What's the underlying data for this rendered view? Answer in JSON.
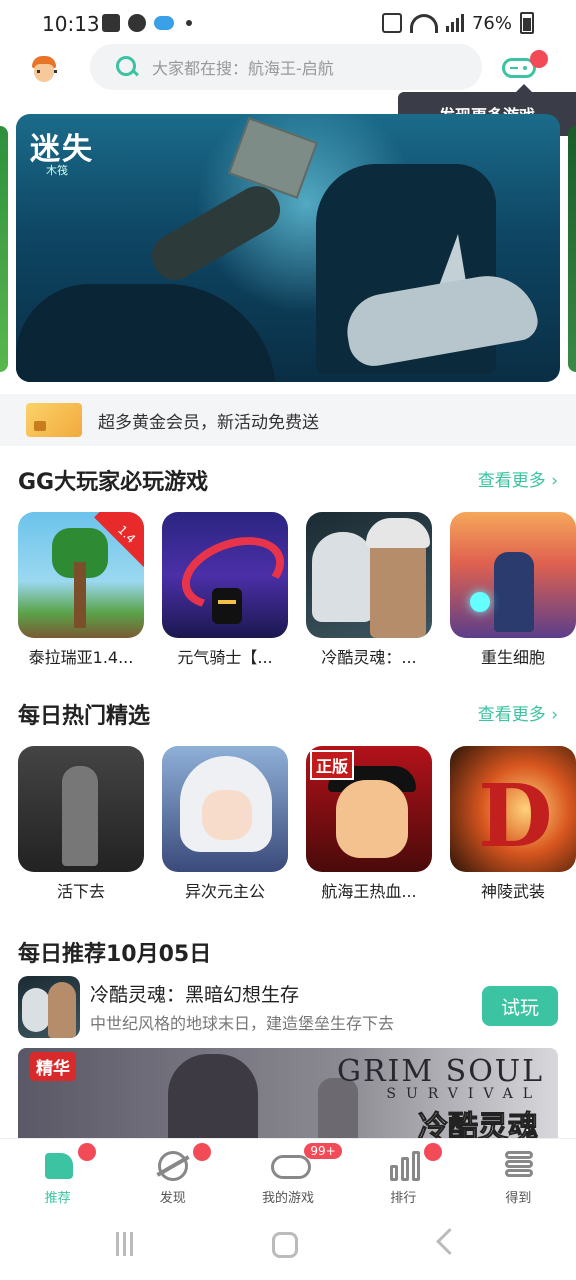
{
  "status_bar": {
    "time": "10:13",
    "battery": "76%"
  },
  "header": {
    "search_placeholder": "大家都在搜：航海王-启航",
    "tooltip": "发现更多游戏"
  },
  "banner": {
    "logo": "迷失",
    "logo_sub": "木筏"
  },
  "promo": {
    "text": "超多黄金会员，新活动免费送"
  },
  "section1": {
    "title": "GG大玩家必玩游戏",
    "more": "查看更多",
    "games": [
      {
        "name": "泰拉瑞亚1.4...",
        "badge": "1.4"
      },
      {
        "name": "元气骑士【..."
      },
      {
        "name": "冷酷灵魂：..."
      },
      {
        "name": "重生细胞"
      }
    ]
  },
  "section2": {
    "title": "每日热门精选",
    "more": "查看更多",
    "games": [
      {
        "name": "活下去"
      },
      {
        "name": "异次元主公"
      },
      {
        "name": "航海王热血...",
        "badge": "正版"
      },
      {
        "name": "神陵武装"
      }
    ]
  },
  "daily": {
    "title": "每日推荐10月05日",
    "game_name": "冷酷灵魂：黑暗幻想生存",
    "game_desc": "中世纪风格的地球末日，建造堡垒生存下去",
    "try_label": "试玩",
    "tag": "精华",
    "logo": "GRIM SOUL",
    "logo_sub": "SURVIVAL",
    "logo_cn": "冷酷灵魂"
  },
  "tabbar": {
    "tabs": [
      {
        "label": "推荐",
        "active": true,
        "dot": true
      },
      {
        "label": "发现",
        "dot": true
      },
      {
        "label": "我的游戏",
        "badge": "99+"
      },
      {
        "label": "排行",
        "dot": true
      },
      {
        "label": "得到"
      }
    ]
  },
  "colors": {
    "accent": "#3cc3a2",
    "badge": "#f24b57",
    "tooltip_bg": "#3a3d48"
  }
}
